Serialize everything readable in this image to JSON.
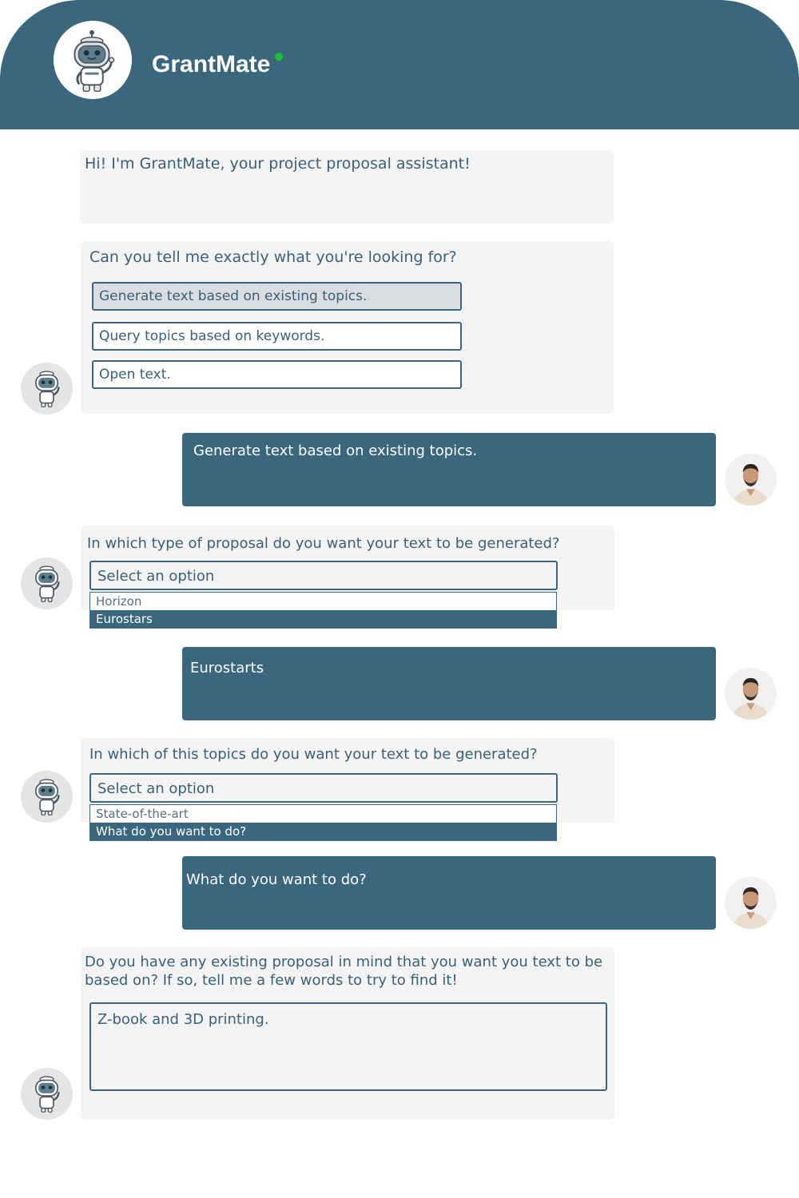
{
  "header": {
    "title": "GrantMate",
    "status_color": "#18c22a",
    "avatar_icon": "robot-icon"
  },
  "colors": {
    "primary": "#3a677e",
    "bot_bubble": "#f4f4f4",
    "text": "#3a6079"
  },
  "messages": {
    "greeting": "Hi! I'm GrantMate, your project proposal assistant!",
    "question1": {
      "text": "Can you tell me exactly what you're looking for?",
      "options": [
        "Generate text based on existing topics.",
        "Query topics based on keywords.",
        "Open text."
      ],
      "selected_index": 0
    },
    "answer1": "Generate text based on existing topics.",
    "question2": {
      "text": "In which type of proposal do you want your text to be generated?",
      "select_placeholder": "Select an option",
      "options": [
        "Horizon",
        "Eurostars"
      ],
      "highlighted": "Eurostars"
    },
    "answer2": "Eurostarts",
    "question3": {
      "text": "In which of this topics do you want your text to be generated?",
      "select_placeholder": "Select an option",
      "options": [
        "State-of-the-art",
        "What do you want to do?"
      ],
      "highlighted": "What do you want to do?"
    },
    "answer3": "What do you want to do?",
    "question4": {
      "line1": "Do you have any existing proposal in mind that you want you text to be",
      "line2": "based on? If so, tell me a few words to try to find it!",
      "input_value": "Z-book and 3D printing."
    }
  },
  "icons": {
    "bot_avatar": "robot-icon",
    "user_avatar": "user-photo-icon"
  }
}
